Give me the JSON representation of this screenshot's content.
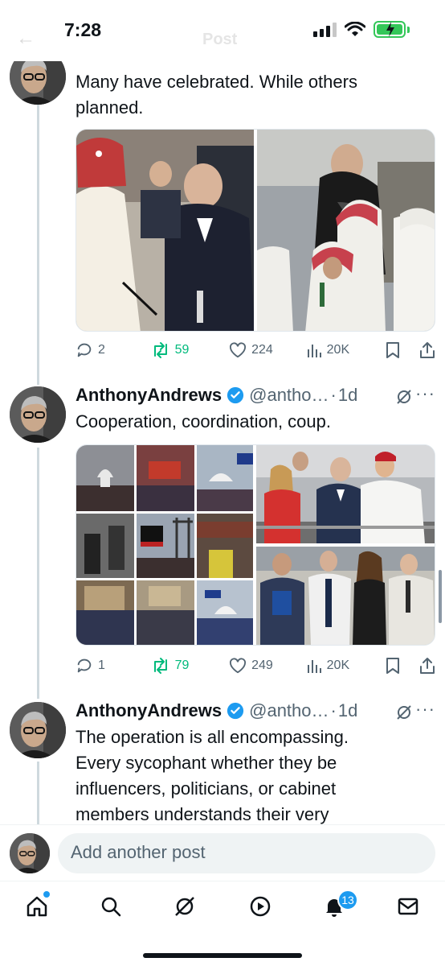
{
  "status": {
    "time": "7:28"
  },
  "header": {
    "title": "Post"
  },
  "tweets": [
    {
      "name": "AnthonyAndrews",
      "handle": "@antho…",
      "time": "1d",
      "text_lines": [
        "Many have celebrated. While others",
        "planned."
      ],
      "media_desc": [
        "Saudi leader greets Putin at summit",
        "Musk in stadium box with Saudi men"
      ],
      "stats": {
        "replies": "2",
        "reposts": "59",
        "likes": "224",
        "views": "20K"
      }
    },
    {
      "name": "AnthonyAndrews",
      "handle": "@antho…",
      "time": "1d",
      "text_lines": [
        "Cooperation, coordination, coup."
      ],
      "stats": {
        "replies": "1",
        "reposts": "79",
        "likes": "249",
        "views": "20K"
      }
    },
    {
      "name": "AnthonyAndrews",
      "handle": "@antho…",
      "time": "1d",
      "text_lines": [
        "The operation is all encompassing.",
        "Every sycophant whether they be",
        "influencers, politicians, or cabinet",
        "members understands their very"
      ]
    }
  ],
  "compose": {
    "placeholder": "Add another post"
  },
  "tabbar": {
    "notifications_badge": "13"
  },
  "colors": {
    "verified": "#1d9bf0",
    "repost": "#00ba7c",
    "text": "#0f1419",
    "muted": "#536471"
  }
}
